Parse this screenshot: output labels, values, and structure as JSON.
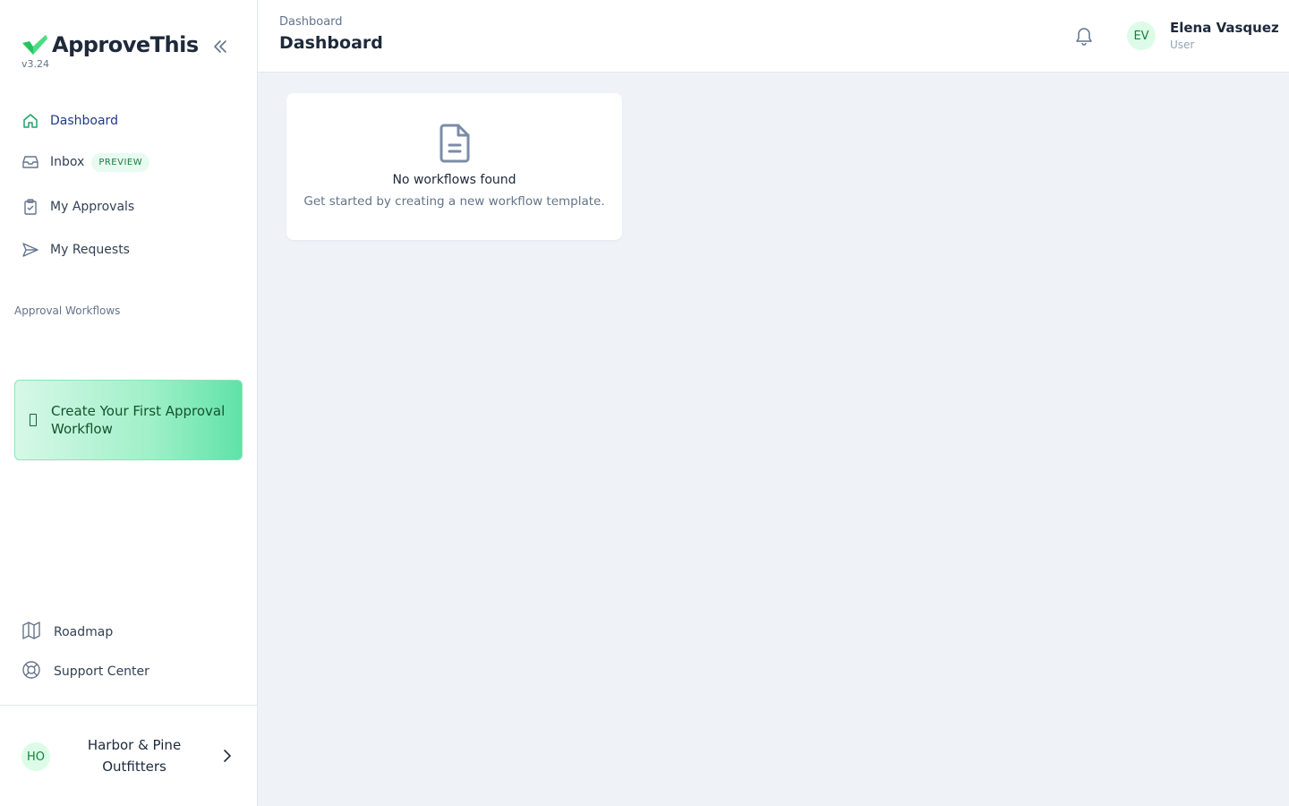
{
  "brand": {
    "name": "ApproveThis",
    "version": "v3.24"
  },
  "sidebar": {
    "items": [
      {
        "label": "Dashboard",
        "icon": "home-icon",
        "active": true
      },
      {
        "label": "Inbox",
        "icon": "inbox-icon",
        "badge": "PREVIEW"
      },
      {
        "label": "My Approvals",
        "icon": "clipboard-check-icon"
      },
      {
        "label": "My Requests",
        "icon": "send-icon"
      }
    ],
    "section_label": "Approval Workflows",
    "cta_label": "Create Your First Approval Workflow",
    "bottom_links": [
      {
        "label": "Roadmap",
        "icon": "map-icon"
      },
      {
        "label": "Support Center",
        "icon": "lifebuoy-icon"
      }
    ],
    "org": {
      "initials": "HO",
      "name": "Harbor & Pine Outfitters"
    }
  },
  "header": {
    "breadcrumb": "Dashboard",
    "title": "Dashboard",
    "user": {
      "initials": "EV",
      "name": "Elena Vasquez",
      "role": "User"
    }
  },
  "empty_state": {
    "title": "No workflows found",
    "subtitle": "Get started by creating a new workflow template."
  },
  "colors": {
    "accent": "#22c55e",
    "background": "#eff3f8",
    "cta_gradient_end": "#5fe2a8"
  }
}
